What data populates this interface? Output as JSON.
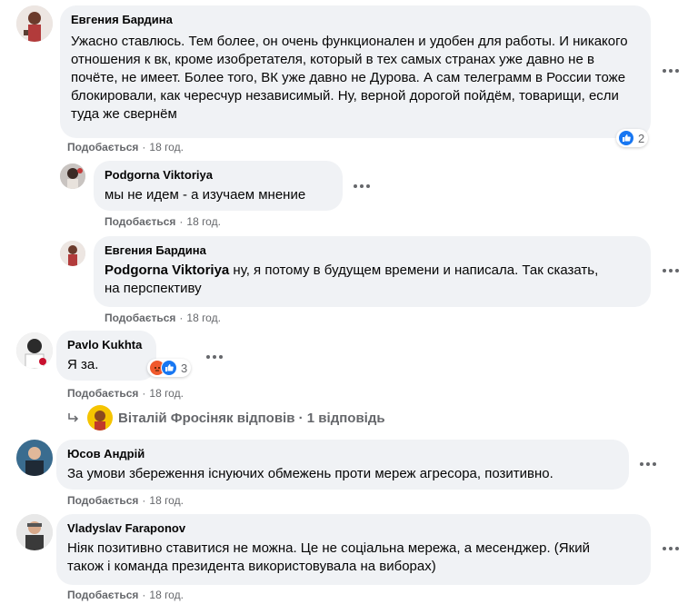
{
  "comments": [
    {
      "author": "Евгения Бардина",
      "text": "Ужасно ставлюсь. Тем более, он очень функционален и удобен для работы. И никакого отношения к вк, кроме изобретателя, который в тех самых странах уже давно не в почёте, не имеет. Более того, ВК уже давно не Дурова. А сам телеграмм в России тоже блокировали, как чересчур независимый. Ну, верной дорогой пойдём, товарищи, если туда же свернём",
      "like_label": "Подобається",
      "time": "18 год.",
      "reaction_count": "2"
    },
    {
      "author": "Podgorna Viktoriya",
      "text": "мы не идем - а изучаем мнение",
      "like_label": "Подобається",
      "time": "18 год."
    },
    {
      "author": "Евгения Бардина",
      "mention": "Podgorna Viktoriya",
      "text": " ну, я потому в будущем времени и написала. Так сказать, на перспективу",
      "like_label": "Подобається",
      "time": "18 год."
    },
    {
      "author": "Pavlo Kukhta",
      "text": "Я за.",
      "like_label": "Подобається",
      "time": "18 год.",
      "reaction_count": "3"
    },
    {
      "author": "Юсов Андрій",
      "text": "За умови збереження існуючих обмежень проти мереж агресора, позитивно.",
      "like_label": "Подобається",
      "time": "18 год."
    },
    {
      "author": "Vladyslav Faraponov",
      "text": "Ніяк позитивно ставитися не можна. Це не соціальна мережа, а месенджер. (Який також і команда президента використовувала на виборах)",
      "like_label": "Подобається",
      "time": "18 год."
    }
  ],
  "replies_link": {
    "name": "Віталій Фросіняк відповів",
    "separator": " · ",
    "count": "1 відповідь"
  },
  "colors": {
    "bubble": "#f0f2f5",
    "meta_text": "#65676b",
    "like_blue": "#1877f2",
    "angry_orange": "#f0592c"
  },
  "icons": [
    "more-options-icon",
    "like-reaction-icon",
    "angry-reaction-icon",
    "reply-arrow-icon"
  ]
}
